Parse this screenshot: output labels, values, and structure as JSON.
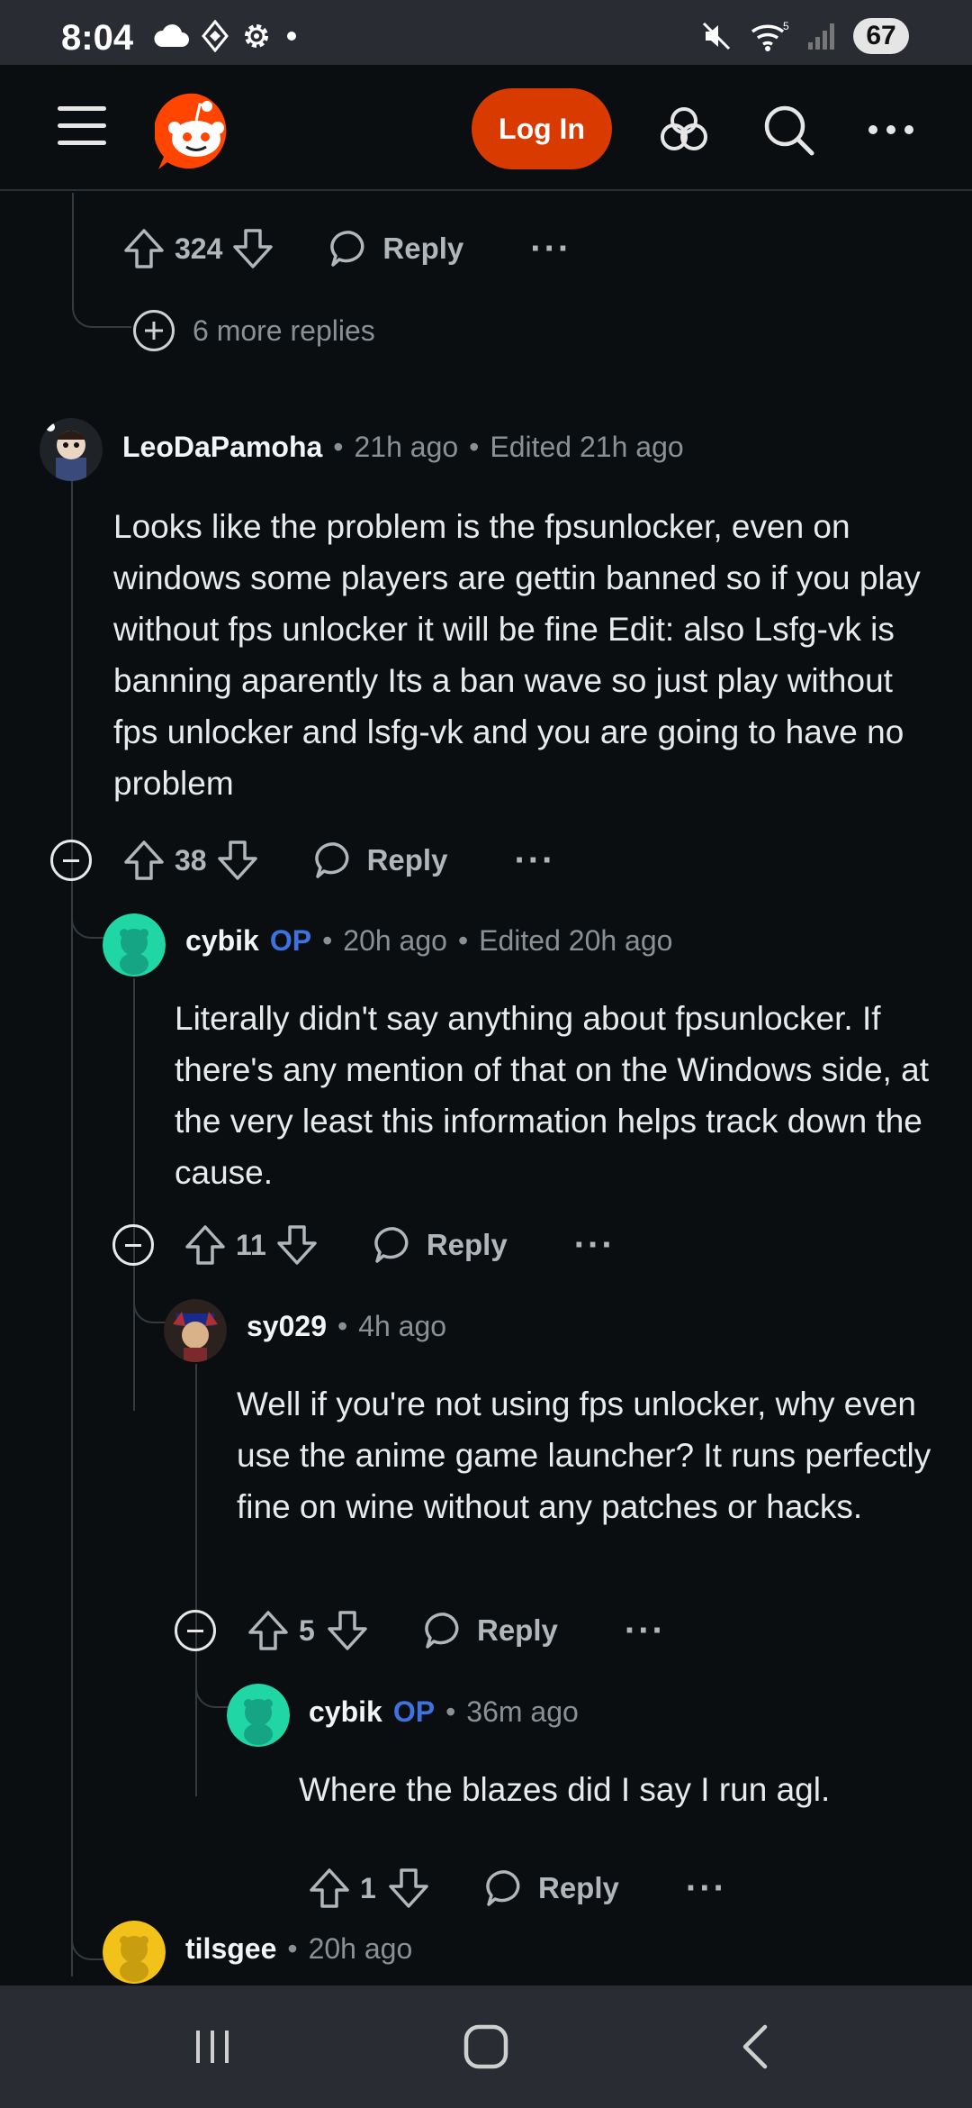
{
  "status_bar": {
    "time": "8:04",
    "battery": "67",
    "icons_left": [
      "cloud-icon",
      "diamond-icon",
      "gear-icon",
      "dot-icon"
    ],
    "icons_right": [
      "mute-icon",
      "wifi-icon",
      "signal-icon"
    ]
  },
  "app_bar": {
    "login_label": "Log In",
    "icons": [
      "menu-icon",
      "reddit-logo",
      "pods-icon",
      "search-icon",
      "more-icon"
    ]
  },
  "prev_comment": {
    "votes": "324",
    "reply_label": "Reply",
    "more_replies": "6 more replies"
  },
  "comments": [
    {
      "user": "LeoDaPamoha",
      "op": "",
      "time": "21h ago",
      "edited": "Edited 21h ago",
      "body": "Looks like the problem is the fpsunlocker, even on windows some players are gettin banned so if you play without fps unlocker it will be fine Edit: also Lsfg-vk is banning aparently Its a ban wave so just play without fps unlocker and lsfg-vk and you are going to have no problem",
      "votes": "38",
      "reply_label": "Reply"
    },
    {
      "user": "cybik",
      "op": "OP",
      "time": "20h ago",
      "edited": "Edited 20h ago",
      "body": "Literally didn't say anything about fpsunlocker. If there's any mention of that on the Windows side, at the very least this information helps track down the cause.",
      "votes": "11",
      "reply_label": "Reply"
    },
    {
      "user": "sy029",
      "op": "",
      "time": "4h ago",
      "edited": "",
      "body": "Well if you're not using fps unlocker, why even use the anime game launcher? It runs perfectly fine on wine without any patches or hacks.",
      "votes": "5",
      "reply_label": "Reply"
    },
    {
      "user": "cybik",
      "op": "OP",
      "time": "36m ago",
      "edited": "",
      "body": "Where the blazes did I say I run agl.",
      "votes": "1",
      "reply_label": "Reply"
    },
    {
      "user": "tilsgee",
      "op": "",
      "time": "20h ago",
      "edited": ""
    }
  ],
  "separator": "•",
  "colors": {
    "background": "#0b0e10",
    "accent": "#d93a00",
    "op": "#3c73e0",
    "muted": "#8a9196"
  }
}
